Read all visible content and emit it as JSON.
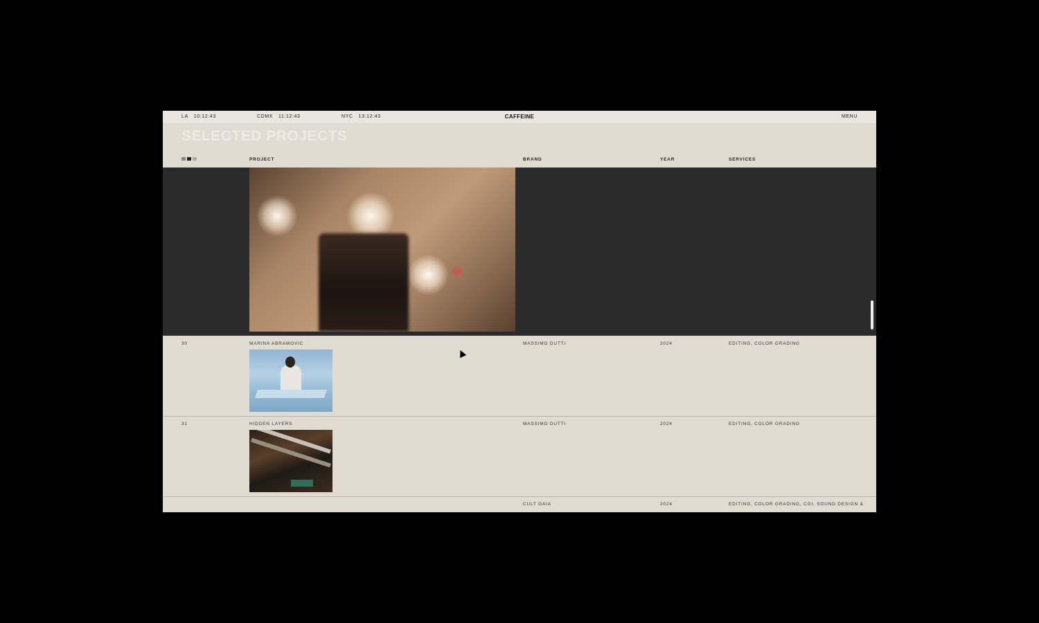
{
  "topbar": {
    "clocks": [
      {
        "city": "LA",
        "time": "10:12:43"
      },
      {
        "city": "CDMX",
        "time": "11:12:43"
      },
      {
        "city": "NYC",
        "time": "13:12:43"
      }
    ],
    "brand": "CAFFEINE",
    "menu_label": "MENU"
  },
  "page_title": "SELECTED PROJECTS",
  "table": {
    "columns": {
      "project": "PROJECT",
      "brand": "BRAND",
      "year": "YEAR",
      "services": "SERVICES"
    },
    "rows": [
      {
        "num": "30",
        "project": "MARINA ABRAMOVIC",
        "brand": "MASSIMO DUTTI",
        "year": "2024",
        "services": "EDITING, COLOR GRADING"
      },
      {
        "num": "31",
        "project": "HIDDEN LAYERS",
        "brand": "MASSIMO DUTTI",
        "year": "2024",
        "services": "EDITING, COLOR GRADING"
      },
      {
        "num": "",
        "project": "",
        "brand": "CULT GAIA",
        "year": "2024",
        "services": "EDITING, COLOR GRADING, CGI, SOUND DESIGN &"
      }
    ]
  },
  "colors": {
    "background": "#e1dcd1",
    "dark_row": "#2a2a2a",
    "title": "#eeebe5"
  }
}
